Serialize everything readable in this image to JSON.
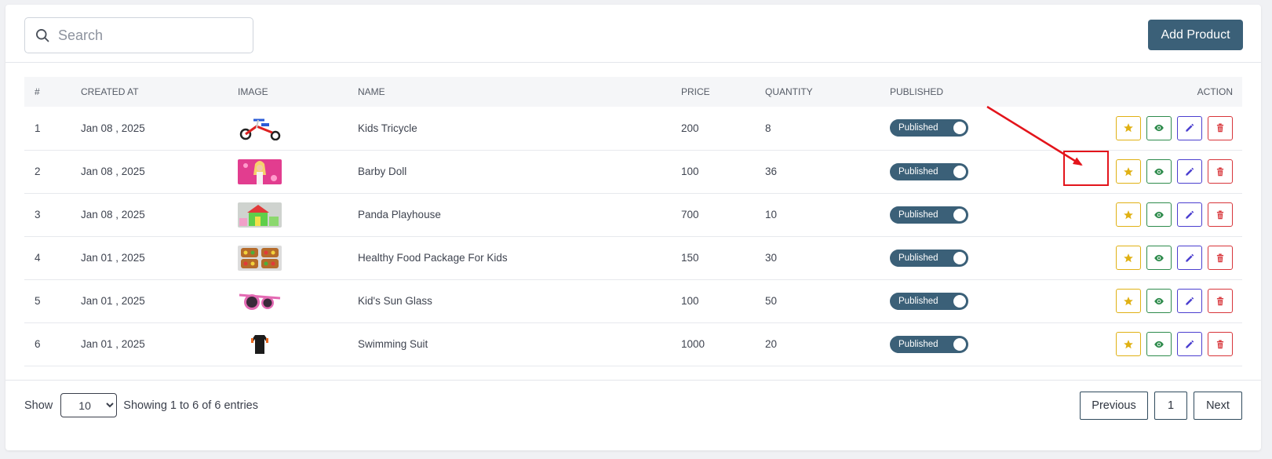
{
  "search": {
    "placeholder": "Search"
  },
  "toolbar": {
    "add_label": "Add Product"
  },
  "table": {
    "headers": [
      "#",
      "CREATED AT",
      "IMAGE",
      "NAME",
      "PRICE",
      "QUANTITY",
      "PUBLISHED",
      "ACTION"
    ],
    "rows": [
      {
        "num": "1",
        "created": "Jan 08 , 2025",
        "image": "tricycle-image",
        "name": "Kids Tricycle",
        "price": "200",
        "qty": "8",
        "published": "Published"
      },
      {
        "num": "2",
        "created": "Jan 08 , 2025",
        "image": "doll-image",
        "name": "Barby Doll",
        "price": "100",
        "qty": "36",
        "published": "Published"
      },
      {
        "num": "3",
        "created": "Jan 08 , 2025",
        "image": "playhouse-image",
        "name": "Panda Playhouse",
        "price": "700",
        "qty": "10",
        "published": "Published"
      },
      {
        "num": "4",
        "created": "Jan 01 , 2025",
        "image": "food-image",
        "name": "Healthy Food Package For Kids",
        "price": "150",
        "qty": "30",
        "published": "Published"
      },
      {
        "num": "5",
        "created": "Jan 01 , 2025",
        "image": "sunglass-image",
        "name": "Kid's Sun Glass",
        "price": "100",
        "qty": "50",
        "published": "Published"
      },
      {
        "num": "6",
        "created": "Jan 01 , 2025",
        "image": "swimsuit-image",
        "name": "Swimming Suit",
        "price": "1000",
        "qty": "20",
        "published": "Published"
      }
    ]
  },
  "footer": {
    "show_label": "Show",
    "page_size": "10",
    "entries_text": "Showing 1 to 6 of 6 entries",
    "prev_label": "Previous",
    "page_number": "1",
    "next_label": "Next"
  },
  "colors": {
    "accent": "#3b6078",
    "star": "#e0b114",
    "view": "#2e8b4c",
    "edit": "#4b3fcf",
    "delete": "#d8353a",
    "annotation": "#e3141b"
  },
  "icons": {
    "search": "search-icon",
    "star": "star-icon",
    "view": "eye-icon",
    "edit": "pencil-icon",
    "delete": "trash-icon"
  }
}
